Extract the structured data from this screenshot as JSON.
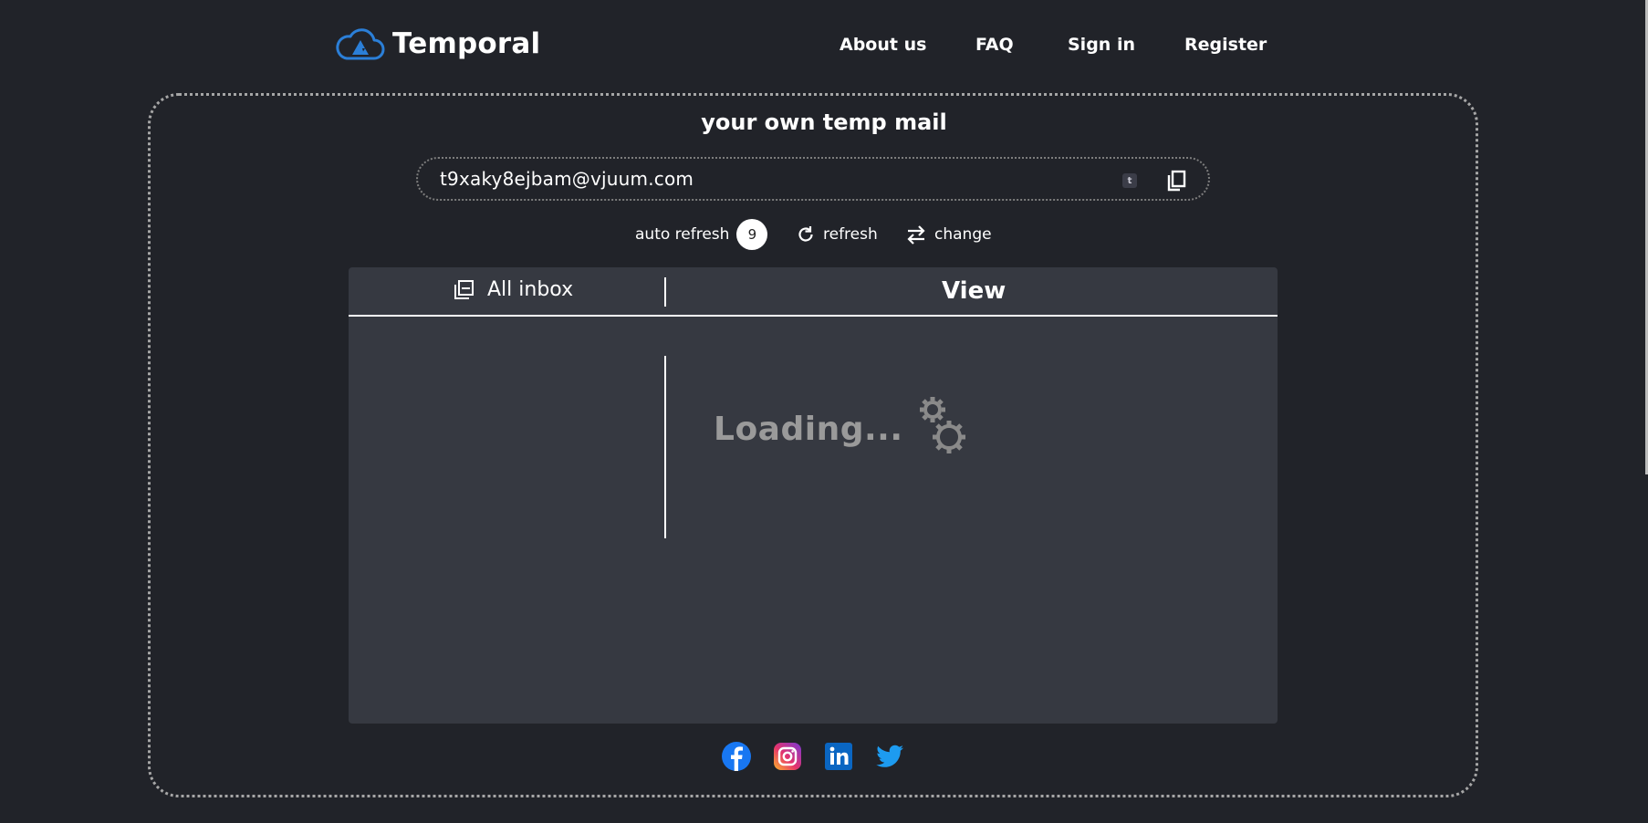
{
  "brand": {
    "name": "Temporal",
    "logo_icon": "cloud-logo-icon",
    "accent": "#2b7fd8"
  },
  "nav": {
    "about": "About us",
    "faq": "FAQ",
    "signin": "Sign in",
    "register": "Register"
  },
  "main": {
    "subtitle": "your own temp mail",
    "email": "t9xaky8ejbam@vjuum.com",
    "badge": "t",
    "controls": {
      "auto_refresh": "auto refresh",
      "countdown": "9",
      "refresh": "refresh",
      "change": "change"
    }
  },
  "panel": {
    "inbox_label": "All inbox",
    "view_label": "View",
    "loading_text": "Loading..."
  },
  "social": {
    "items": [
      "facebook-icon",
      "instagram-icon",
      "linkedin-icon",
      "twitter-icon"
    ]
  }
}
